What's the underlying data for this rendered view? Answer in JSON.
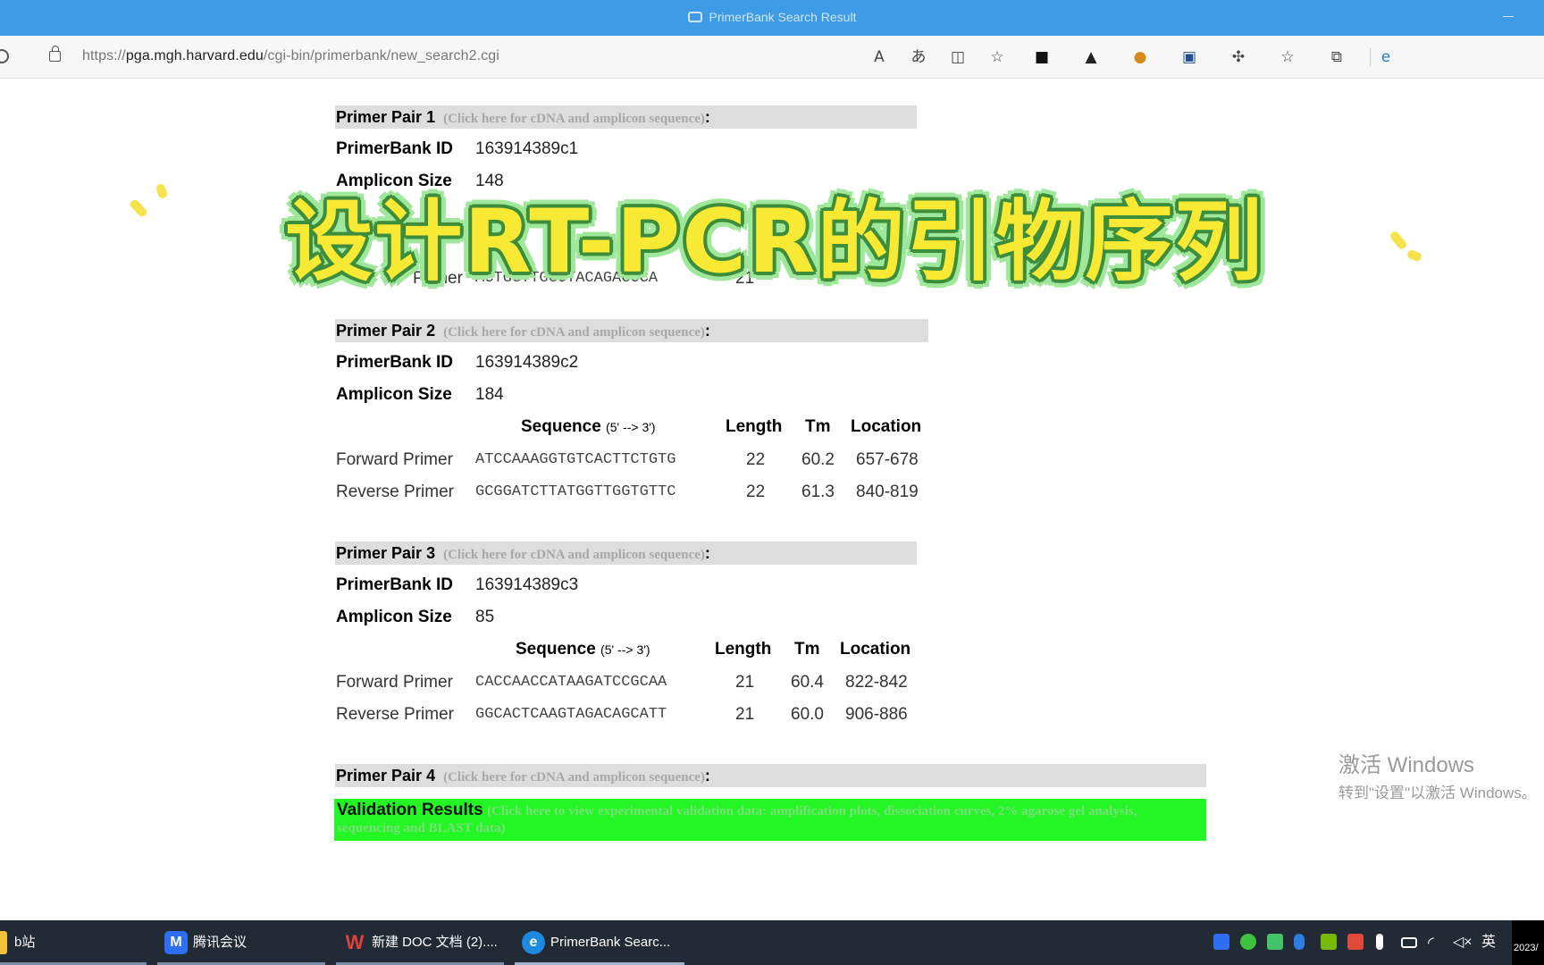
{
  "window": {
    "title": "PrimerBank Search Result"
  },
  "address": {
    "url_prefix": "https://",
    "url_host": "pga.mgh.harvard.edu",
    "url_path": "/cgi-bin/primerbank/new_search2.cgi"
  },
  "toolbar": {
    "icons": [
      "read-aloud-icon",
      "translate-icon",
      "split-screen-icon",
      "add-favorite-icon",
      "extension-icon",
      "extension-icon",
      "extension-icon",
      "extension-icon",
      "extensions-icon",
      "favorites-icon",
      "collections-icon",
      "edge-icon"
    ]
  },
  "overlay": {
    "caption": "设计RT-PCR的引物序列"
  },
  "labels": {
    "pair_prefix": "Primer Pair",
    "hint": "(Click here for cDNA and amplicon sequence)",
    "colon": ":",
    "primerbank_id": "PrimerBank ID",
    "amplicon_size": "Amplicon Size",
    "sequence": "Sequence",
    "direction": "(5' --> 3')",
    "length": "Length",
    "tm": "Tm",
    "location": "Location",
    "forward": "Forward Primer",
    "reverse": "Reverse Primer"
  },
  "pairs": [
    {
      "number": "1",
      "id": "163914389c1",
      "amplicon": "148",
      "partial_sequence_header": "nce",
      "partial_reverse_label": "Primer",
      "partial_reverse_seq": "ACTGGTTGGCTACAGACCCA",
      "partial_reverse_len": "21"
    },
    {
      "number": "2",
      "id": "163914389c2",
      "amplicon": "184",
      "forward": {
        "seq": "ATCCAAAGGTGTCACTTCTGTG",
        "length": "22",
        "tm": "60.2",
        "location": "657-678"
      },
      "reverse": {
        "seq": "GCGGATCTTATGGTTGGTGTTC",
        "length": "22",
        "tm": "61.3",
        "location": "840-819"
      }
    },
    {
      "number": "3",
      "id": "163914389c3",
      "amplicon": "85",
      "forward": {
        "seq": "CACCAACCATAAGATCCGCAA",
        "length": "21",
        "tm": "60.4",
        "location": "822-842"
      },
      "reverse": {
        "seq": "GGCACTCAAGTAGACAGCATT",
        "length": "21",
        "tm": "60.0",
        "location": "906-886"
      }
    },
    {
      "number": "4"
    }
  ],
  "validation": {
    "title": "Validation Results",
    "hint": "(Click here to view experimental validation data: amplification plots, dissociation curves, 2% agarose gel analysis, sequencing and BLAST data)"
  },
  "watermark": {
    "line1": "激活 Windows",
    "line2": "转到\"设置\"以激活 Windows。"
  },
  "taskbar": {
    "items": [
      {
        "label": "b站",
        "icon": "bilibili-icon"
      },
      {
        "label": "腾讯会议",
        "icon": "tencent-meeting-icon"
      },
      {
        "label": "新建 DOC 文档 (2)....",
        "icon": "wps-icon"
      },
      {
        "label": "PrimerBank Searc...",
        "icon": "edge-icon"
      }
    ],
    "ime": "英",
    "clock_fragment": "2023/"
  },
  "colors": {
    "titlebar": "#3e9be6",
    "validation_bg": "#24f524",
    "pair_header_bg": "#dddddd",
    "overlay_fill": "#f7e934",
    "overlay_outline": "#3d8d3a",
    "taskbar": "#222a35"
  }
}
